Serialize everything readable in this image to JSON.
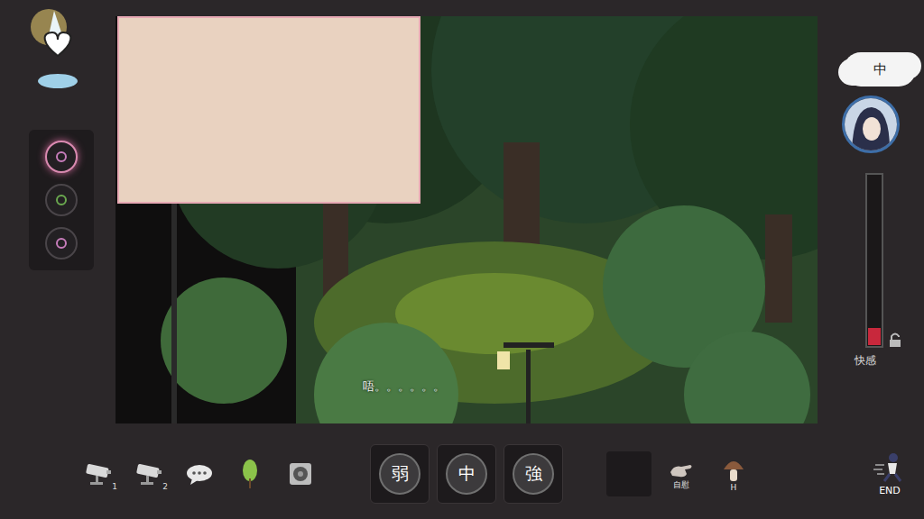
{
  "side_buttons": [
    {
      "selected": true
    },
    {
      "selected": false
    },
    {
      "selected": false
    }
  ],
  "scene": {
    "dialogue": "唔。。。。。。"
  },
  "status": {
    "thought": "中",
    "meter": {
      "label": "快感",
      "level": 0.1,
      "locked": false
    }
  },
  "intensity_buttons": [
    {
      "label": "弱",
      "selected": false
    },
    {
      "label": "中",
      "selected": false
    },
    {
      "label": "強",
      "selected": false
    }
  ],
  "toolbar": [
    {
      "kind": "camera",
      "label": "1"
    },
    {
      "kind": "camera",
      "label": "2"
    },
    {
      "kind": "chat",
      "label": ""
    },
    {
      "kind": "tree",
      "label": ""
    },
    {
      "kind": "speaker",
      "label": ""
    }
  ],
  "actions": [
    {
      "kind": "empty",
      "label": ""
    },
    {
      "kind": "hand",
      "label": "自慰"
    },
    {
      "kind": "mushroom",
      "label": "H"
    }
  ],
  "end": {
    "label": "END"
  }
}
